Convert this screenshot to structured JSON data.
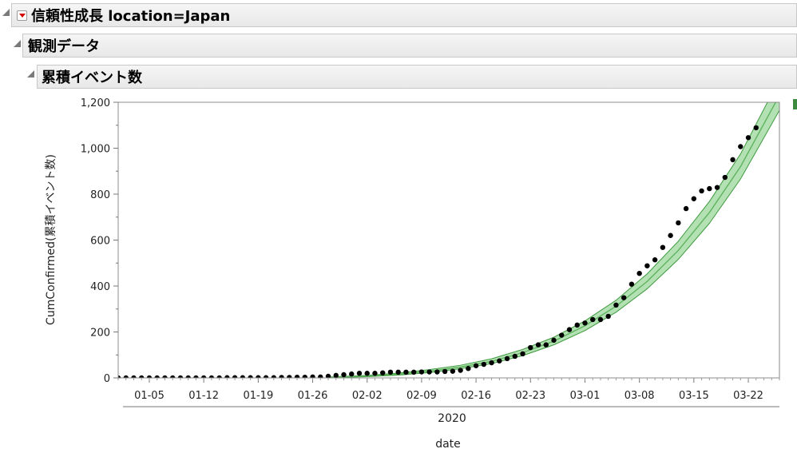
{
  "report": {
    "title": "信頼性成長 location=Japan",
    "section_observed": "観測データ",
    "section_cumulative": "累積イベント数"
  },
  "colors": {
    "points": "#000000",
    "fit_line": "#5fb35f",
    "band": "#a6dca6",
    "band_edge": "#3e9a3e",
    "frame": "#8c8c8c"
  },
  "chart_data": {
    "type": "scatter",
    "title": "",
    "xlabel": "date",
    "x_group_label": "2020",
    "ylabel": "CumConfirmed(累積イベント数)",
    "ylim": [
      0,
      1200
    ],
    "yticks": [
      "0",
      "200",
      "400",
      "600",
      "800",
      "1,000",
      "1,200"
    ],
    "x_range": [
      "2020-01-01",
      "2020-03-26"
    ],
    "xticks": [
      {
        "date": "2020-01-05",
        "label": "01-05"
      },
      {
        "date": "2020-01-12",
        "label": "01-12"
      },
      {
        "date": "2020-01-19",
        "label": "01-19"
      },
      {
        "date": "2020-01-26",
        "label": "01-26"
      },
      {
        "date": "2020-02-02",
        "label": "02-02"
      },
      {
        "date": "2020-02-09",
        "label": "02-09"
      },
      {
        "date": "2020-02-16",
        "label": "02-16"
      },
      {
        "date": "2020-02-23",
        "label": "02-23"
      },
      {
        "date": "2020-03-01",
        "label": "03-01"
      },
      {
        "date": "2020-03-08",
        "label": "03-08"
      },
      {
        "date": "2020-03-15",
        "label": "03-15"
      },
      {
        "date": "2020-03-22",
        "label": "03-22"
      }
    ],
    "grid": false,
    "series": [
      {
        "type": "scatter",
        "values": [
          [
            "2020-01-01",
            0
          ],
          [
            "2020-01-02",
            0
          ],
          [
            "2020-01-03",
            0
          ],
          [
            "2020-01-04",
            0
          ],
          [
            "2020-01-05",
            0
          ],
          [
            "2020-01-06",
            0
          ],
          [
            "2020-01-07",
            0
          ],
          [
            "2020-01-08",
            0
          ],
          [
            "2020-01-09",
            0
          ],
          [
            "2020-01-10",
            0
          ],
          [
            "2020-01-11",
            0
          ],
          [
            "2020-01-12",
            0
          ],
          [
            "2020-01-13",
            0
          ],
          [
            "2020-01-14",
            0
          ],
          [
            "2020-01-15",
            1
          ],
          [
            "2020-01-16",
            1
          ],
          [
            "2020-01-17",
            1
          ],
          [
            "2020-01-18",
            1
          ],
          [
            "2020-01-19",
            1
          ],
          [
            "2020-01-20",
            1
          ],
          [
            "2020-01-21",
            1
          ],
          [
            "2020-01-22",
            2
          ],
          [
            "2020-01-23",
            2
          ],
          [
            "2020-01-24",
            3
          ],
          [
            "2020-01-25",
            3
          ],
          [
            "2020-01-26",
            4
          ],
          [
            "2020-01-27",
            4
          ],
          [
            "2020-01-28",
            7
          ],
          [
            "2020-01-29",
            11
          ],
          [
            "2020-01-30",
            14
          ],
          [
            "2020-01-31",
            17
          ],
          [
            "2020-02-01",
            20
          ],
          [
            "2020-02-02",
            20
          ],
          [
            "2020-02-03",
            20
          ],
          [
            "2020-02-04",
            22
          ],
          [
            "2020-02-05",
            25
          ],
          [
            "2020-02-06",
            25
          ],
          [
            "2020-02-07",
            25
          ],
          [
            "2020-02-08",
            25
          ],
          [
            "2020-02-09",
            26
          ],
          [
            "2020-02-10",
            26
          ],
          [
            "2020-02-11",
            26
          ],
          [
            "2020-02-12",
            28
          ],
          [
            "2020-02-13",
            29
          ],
          [
            "2020-02-14",
            33
          ],
          [
            "2020-02-15",
            41
          ],
          [
            "2020-02-16",
            53
          ],
          [
            "2020-02-17",
            59
          ],
          [
            "2020-02-18",
            66
          ],
          [
            "2020-02-19",
            74
          ],
          [
            "2020-02-20",
            84
          ],
          [
            "2020-02-21",
            94
          ],
          [
            "2020-02-22",
            105
          ],
          [
            "2020-02-23",
            132
          ],
          [
            "2020-02-24",
            144
          ],
          [
            "2020-02-25",
            144
          ],
          [
            "2020-02-26",
            164
          ],
          [
            "2020-02-27",
            186
          ],
          [
            "2020-02-28",
            210
          ],
          [
            "2020-02-29",
            230
          ],
          [
            "2020-03-01",
            239
          ],
          [
            "2020-03-02",
            254
          ],
          [
            "2020-03-03",
            254
          ],
          [
            "2020-03-04",
            268
          ],
          [
            "2020-03-05",
            317
          ],
          [
            "2020-03-06",
            349
          ],
          [
            "2020-03-07",
            408
          ],
          [
            "2020-03-08",
            455
          ],
          [
            "2020-03-09",
            488
          ],
          [
            "2020-03-10",
            514
          ],
          [
            "2020-03-11",
            568
          ],
          [
            "2020-03-12",
            620
          ],
          [
            "2020-03-13",
            675
          ],
          [
            "2020-03-14",
            737
          ],
          [
            "2020-03-15",
            780
          ],
          [
            "2020-03-16",
            814
          ],
          [
            "2020-03-17",
            824
          ],
          [
            "2020-03-18",
            829
          ],
          [
            "2020-03-19",
            873
          ],
          [
            "2020-03-20",
            950
          ],
          [
            "2020-03-21",
            1007
          ],
          [
            "2020-03-22",
            1046
          ],
          [
            "2020-03-23",
            1089
          ]
        ]
      },
      {
        "type": "line",
        "values": [
          [
            "2020-01-28",
            2
          ],
          [
            "2020-02-02",
            8
          ],
          [
            "2020-02-06",
            16
          ],
          [
            "2020-02-10",
            29
          ],
          [
            "2020-02-14",
            47
          ],
          [
            "2020-02-18",
            72
          ],
          [
            "2020-02-22",
            110
          ],
          [
            "2020-02-26",
            160
          ],
          [
            "2020-03-01",
            227
          ],
          [
            "2020-03-05",
            312
          ],
          [
            "2020-03-09",
            420
          ],
          [
            "2020-03-13",
            555
          ],
          [
            "2020-03-17",
            720
          ],
          [
            "2020-03-21",
            920
          ],
          [
            "2020-03-26",
            1230
          ]
        ],
        "lower": [
          [
            "2020-01-28",
            1
          ],
          [
            "2020-02-02",
            5
          ],
          [
            "2020-02-06",
            12
          ],
          [
            "2020-02-10",
            23
          ],
          [
            "2020-02-14",
            40
          ],
          [
            "2020-02-18",
            62
          ],
          [
            "2020-02-22",
            97
          ],
          [
            "2020-02-26",
            144
          ],
          [
            "2020-03-01",
            206
          ],
          [
            "2020-03-05",
            286
          ],
          [
            "2020-03-09",
            388
          ],
          [
            "2020-03-13",
            516
          ],
          [
            "2020-03-17",
            673
          ],
          [
            "2020-03-21",
            866
          ],
          [
            "2020-03-26",
            1165
          ]
        ],
        "upper": [
          [
            "2020-01-28",
            4
          ],
          [
            "2020-02-02",
            11
          ],
          [
            "2020-02-06",
            21
          ],
          [
            "2020-02-10",
            36
          ],
          [
            "2020-02-14",
            55
          ],
          [
            "2020-02-18",
            83
          ],
          [
            "2020-02-22",
            124
          ],
          [
            "2020-02-26",
            177
          ],
          [
            "2020-03-01",
            248
          ],
          [
            "2020-03-05",
            338
          ],
          [
            "2020-03-09",
            453
          ],
          [
            "2020-03-13",
            595
          ],
          [
            "2020-03-17",
            768
          ],
          [
            "2020-03-21",
            975
          ],
          [
            "2020-03-26",
            1300
          ]
        ]
      }
    ]
  }
}
